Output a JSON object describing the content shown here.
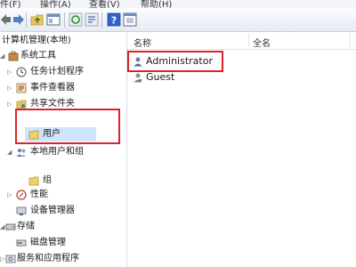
{
  "menu": {
    "items": [
      "件(F)",
      "操作(A)",
      "查看(V)",
      "帮助(H)"
    ]
  },
  "toolbar": {
    "icons": [
      "back-icon",
      "forward-icon",
      "up-folder-icon",
      "console-tree-icon",
      "refresh-icon",
      "export-icon",
      "help-icon",
      "properties-icon"
    ]
  },
  "tree": {
    "root": "计算机管理(本地)",
    "system_tools": "系统工具",
    "task_scheduler": "任务计划程序",
    "event_viewer": "事件查看器",
    "shared_folders": "共享文件夹",
    "local_users_groups": "本地用户和组",
    "users": "用户",
    "groups": "组",
    "performance": "性能",
    "device_manager": "设备管理器",
    "storage": "存储",
    "disk_management": "磁盘管理",
    "services_apps": "服务和应用程序"
  },
  "list": {
    "columns": [
      "名称",
      "全名"
    ],
    "rows": [
      {
        "name": "Administrator"
      },
      {
        "name": "Guest"
      }
    ]
  },
  "colors": {
    "highlight": "#d9242b",
    "selection": "#cfe3fb"
  }
}
